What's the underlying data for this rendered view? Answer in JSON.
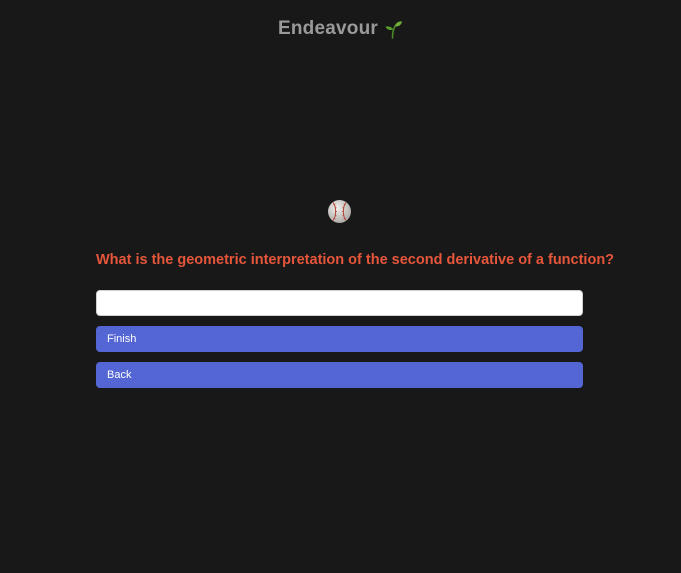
{
  "header": {
    "title": "Endeavour",
    "icon": "sprout-icon"
  },
  "quiz": {
    "ball_icon": "baseball-icon",
    "question": "What is the geometric interpretation of the second derivative of a function?",
    "answer_value": "",
    "answer_placeholder": ""
  },
  "actions": {
    "finish_label": "Finish",
    "back_label": "Back"
  },
  "colors": {
    "background": "#181818",
    "title": "#9a9a9a",
    "question": "#e5563b",
    "button": "#5366d3"
  }
}
